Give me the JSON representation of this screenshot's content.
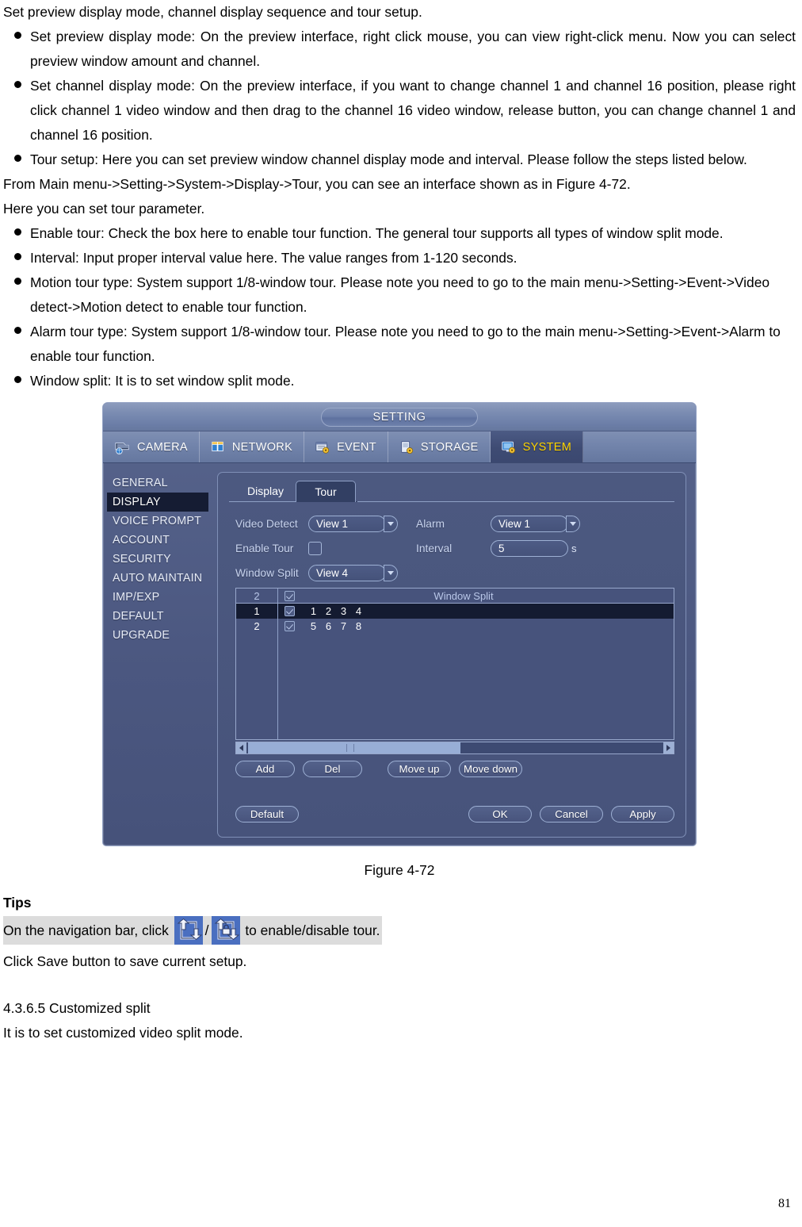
{
  "document": {
    "intro": "Set preview display mode, channel display sequence and tour setup.",
    "bullets_top": [
      "Set preview display mode: On the preview interface, right click mouse, you can view right-click menu. Now you can select preview window amount and channel.",
      "Set channel display mode: On the preview interface, if you want to change channel 1 and channel 16 position, please right click channel 1 video window and then drag to the channel 16 video window, release button, you can change channel 1 and channel 16 position.",
      "Tour setup: Here you can set preview window channel display mode and interval. Please follow the steps listed below."
    ],
    "path_line_1": "From Main menu->Setting->System->Display->Tour, you can see an interface shown as in Figure 4-72.",
    "path_line_2": "Here you can set tour parameter.",
    "bullets_mid": [
      "Enable tour: Check the box here to enable tour function. The general tour supports all types of window split mode.",
      "Interval: Input proper interval value here. The value ranges from 1-120 seconds.",
      "Motion tour type: System support 1/8-window tour. Please note you need to go to the main menu->Setting->Event->Video detect->Motion detect to enable tour function.",
      "Alarm tour type: System support 1/8-window tour. Please note you need to go to the main menu->Setting->Event->Alarm to enable tour function.",
      "Window split: It is to set window split mode."
    ],
    "figure_caption": "Figure 4-72",
    "tips_heading": "Tips",
    "tips_prefix": "On the navigation bar, click",
    "tips_slash": "/",
    "tips_suffix": "to enable/disable tour.",
    "save_note": "Click Save button to save current setup.",
    "section_heading": "4.3.6.5 Customized split",
    "section_body": "It is to set customized video split mode.",
    "page_number": "81"
  },
  "nvr": {
    "window_title": "SETTING",
    "tabs": [
      {
        "label": "CAMERA",
        "icon": "camera-icon",
        "active": false
      },
      {
        "label": "NETWORK",
        "icon": "network-icon",
        "active": false
      },
      {
        "label": "EVENT",
        "icon": "event-icon",
        "active": false
      },
      {
        "label": "STORAGE",
        "icon": "storage-icon",
        "active": false
      },
      {
        "label": "SYSTEM",
        "icon": "system-icon",
        "active": true
      }
    ],
    "sidebar": [
      {
        "label": "GENERAL",
        "selected": false
      },
      {
        "label": "DISPLAY",
        "selected": true
      },
      {
        "label": "VOICE PROMPT",
        "selected": false
      },
      {
        "label": "ACCOUNT",
        "selected": false
      },
      {
        "label": "SECURITY",
        "selected": false
      },
      {
        "label": "AUTO MAINTAIN",
        "selected": false
      },
      {
        "label": "IMP/EXP",
        "selected": false
      },
      {
        "label": "DEFAULT",
        "selected": false
      },
      {
        "label": "UPGRADE",
        "selected": false
      }
    ],
    "inner_tabs": [
      {
        "label": "Display",
        "active": false
      },
      {
        "label": "Tour",
        "active": true
      }
    ],
    "form": {
      "video_detect_label": "Video Detect",
      "video_detect_value": "View 1",
      "alarm_label": "Alarm",
      "alarm_value": "View 1",
      "enable_tour_label": "Enable Tour",
      "enable_tour_checked": false,
      "interval_label": "Interval",
      "interval_value": "5",
      "interval_unit": "s",
      "window_split_label": "Window Split",
      "window_split_value": "View 4"
    },
    "table": {
      "header_num": "2",
      "header_title": "Window Split",
      "rows": [
        {
          "num": "1",
          "checked": true,
          "channels": [
            "1",
            "2",
            "3",
            "4"
          ],
          "selected": true
        },
        {
          "num": "2",
          "checked": true,
          "channels": [
            "5",
            "6",
            "7",
            "8"
          ],
          "selected": false
        }
      ]
    },
    "list_buttons": [
      {
        "label": "Add"
      },
      {
        "label": "Del"
      },
      {
        "label": "Move up"
      },
      {
        "label": "Move down"
      }
    ],
    "footer_buttons": {
      "default": "Default",
      "ok": "OK",
      "cancel": "Cancel",
      "apply": "Apply"
    }
  },
  "colors": {
    "accent_yellow": "#ffd400",
    "dialog_blue": "#4b5780",
    "selected_row": "#141b31",
    "tips_highlight": "#dcdcdc"
  }
}
